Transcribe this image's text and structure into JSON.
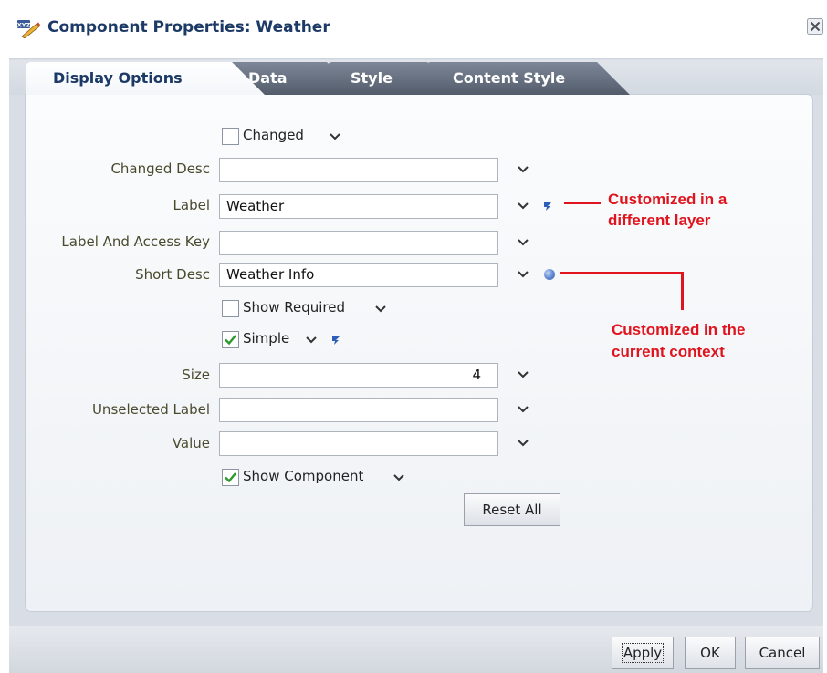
{
  "dialog": {
    "title": "Component Properties: Weather"
  },
  "tabs": [
    {
      "label": "Display Options",
      "active": true
    },
    {
      "label": "Data",
      "active": false
    },
    {
      "label": "Style",
      "active": false
    },
    {
      "label": "Content Style",
      "active": false
    }
  ],
  "form": {
    "changed": {
      "label": "Changed",
      "checked": false
    },
    "changed_desc": {
      "label": "Changed Desc",
      "value": ""
    },
    "label": {
      "label": "Label",
      "value": "Weather"
    },
    "label_access_key": {
      "label": "Label And Access Key",
      "value": ""
    },
    "short_desc": {
      "label": "Short Desc",
      "value": "Weather Info"
    },
    "show_required": {
      "label": "Show Required",
      "checked": false
    },
    "simple": {
      "label": "Simple",
      "checked": true
    },
    "size": {
      "label": "Size",
      "value": "4"
    },
    "unselected_label": {
      "label": "Unselected Label",
      "value": ""
    },
    "value": {
      "label": "Value",
      "value": ""
    },
    "show_component": {
      "label": "Show Component",
      "checked": true
    },
    "reset_all": "Reset All"
  },
  "annotations": {
    "layer_line1": "Customized in a",
    "layer_line2": "different layer",
    "context_line1": "Customized in the",
    "context_line2": "current context"
  },
  "footer": {
    "apply": "Apply",
    "ok": "OK",
    "cancel": "Cancel"
  },
  "colors": {
    "accent": "#1d3a66",
    "annotation": "#e0141e",
    "checkmark": "#2e9a2e",
    "layer_icon": "#2d5fb8"
  },
  "icons": {
    "title": "property-inspector-icon",
    "close": "close-icon",
    "dropdown": "chevron-down-icon",
    "layer": "customized-different-layer-icon",
    "context": "customized-current-context-icon"
  }
}
